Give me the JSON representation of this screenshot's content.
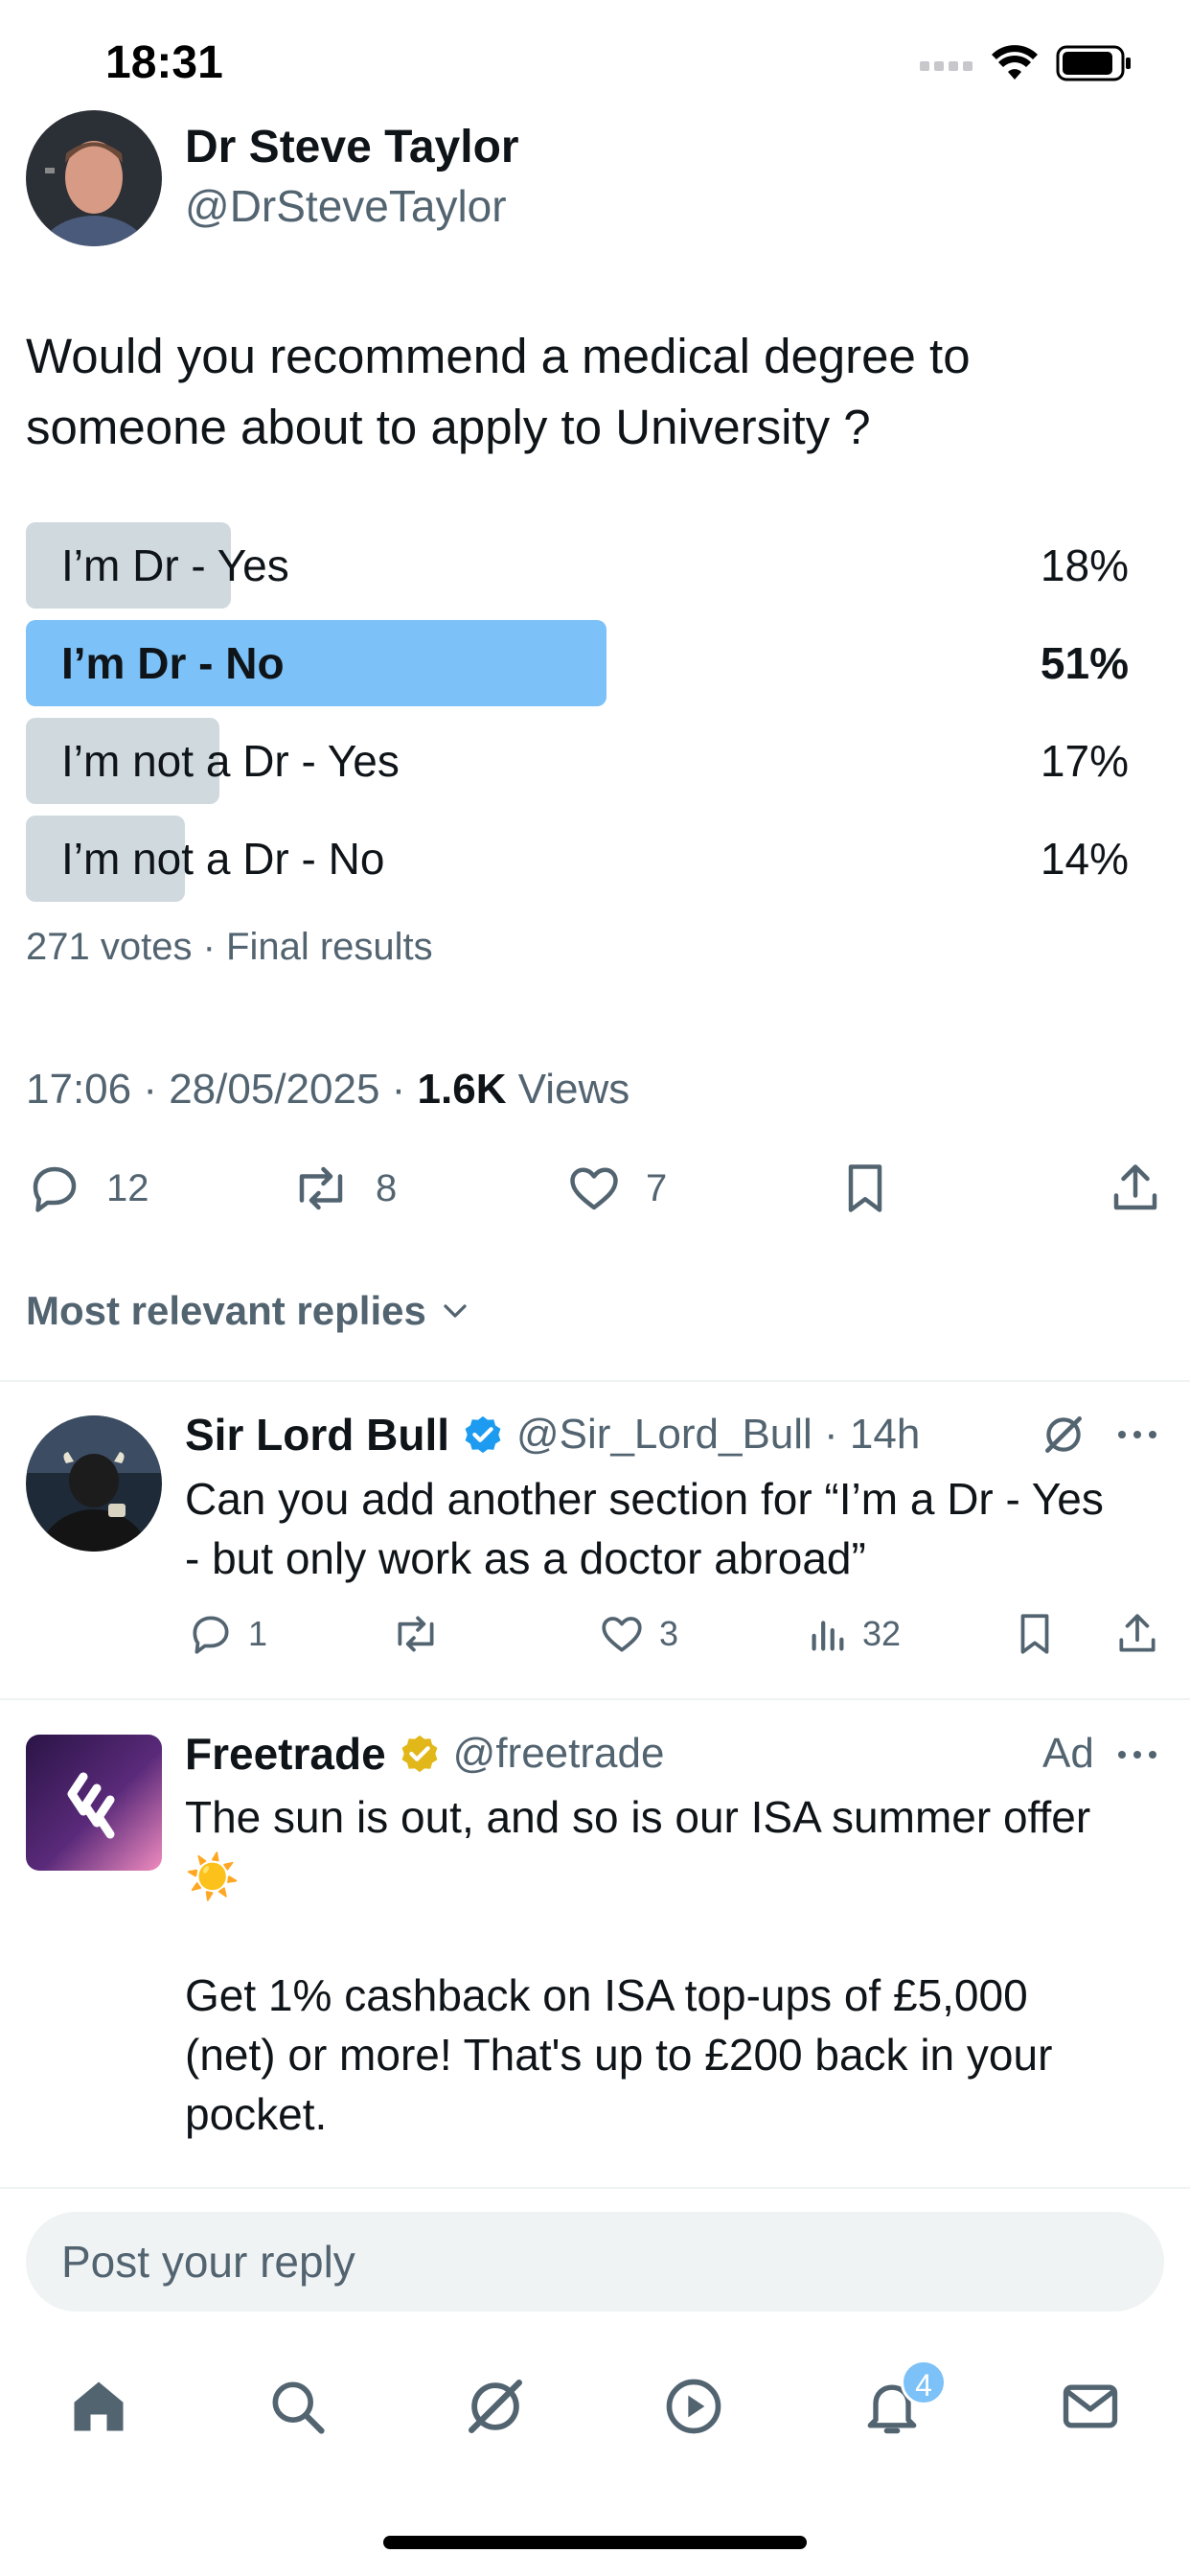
{
  "status_bar": {
    "time": "18:31"
  },
  "author": {
    "name": "Dr Steve Taylor",
    "handle": "@DrSteveTaylor"
  },
  "post": {
    "text_line1": "Would you recommend a medical degree to",
    "text_line2": "someone about to apply to University ?"
  },
  "poll": {
    "options": [
      {
        "label": "I’m Dr - Yes",
        "percent_label": "18%",
        "percent": 18,
        "winner": false
      },
      {
        "label": "I’m Dr - No",
        "percent_label": "51%",
        "percent": 51,
        "winner": true
      },
      {
        "label": "I’m not a Dr - Yes",
        "percent_label": "17%",
        "percent": 17,
        "winner": false
      },
      {
        "label": "I’m not a Dr - No",
        "percent_label": "14%",
        "percent": 14,
        "winner": false
      }
    ],
    "meta": "271 votes · Final results"
  },
  "timestamp": {
    "time": "17:06 · 28/05/2025 · ",
    "views_count": "1.6K",
    "views_label": " Views"
  },
  "actions": {
    "replies": "12",
    "reposts": "8",
    "likes": "7"
  },
  "replies_filter": {
    "label": "Most relevant replies"
  },
  "reply1": {
    "name": "Sir Lord Bull",
    "handle": "@Sir_Lord_Bull · 14h",
    "text_line1": "Can you add another section for “I’m a Dr - Yes",
    "text_line2": "- but only work as a doctor abroad”",
    "replies": "1",
    "likes": "3",
    "views": "32"
  },
  "ad": {
    "name": "Freetrade",
    "handle": "@freetrade",
    "ad_label": "Ad",
    "text_line1": "The sun is out, and so is our ISA summer offer",
    "text_line2": "☀️",
    "text_line3": "Get 1% cashback on ISA top-ups of £5,000",
    "text_line4": "(net) or more! That's up to £200 back in your",
    "text_line5": "pocket."
  },
  "reply_input": {
    "placeholder": "Post your reply"
  },
  "tab_bar": {
    "notifications_badge": "4"
  },
  "colors": {
    "accent": "#1d9bf0",
    "poll_winner": "#7cc1f7",
    "poll_bar": "#cfd9de",
    "muted": "#536471",
    "gold": "#e2b719"
  }
}
